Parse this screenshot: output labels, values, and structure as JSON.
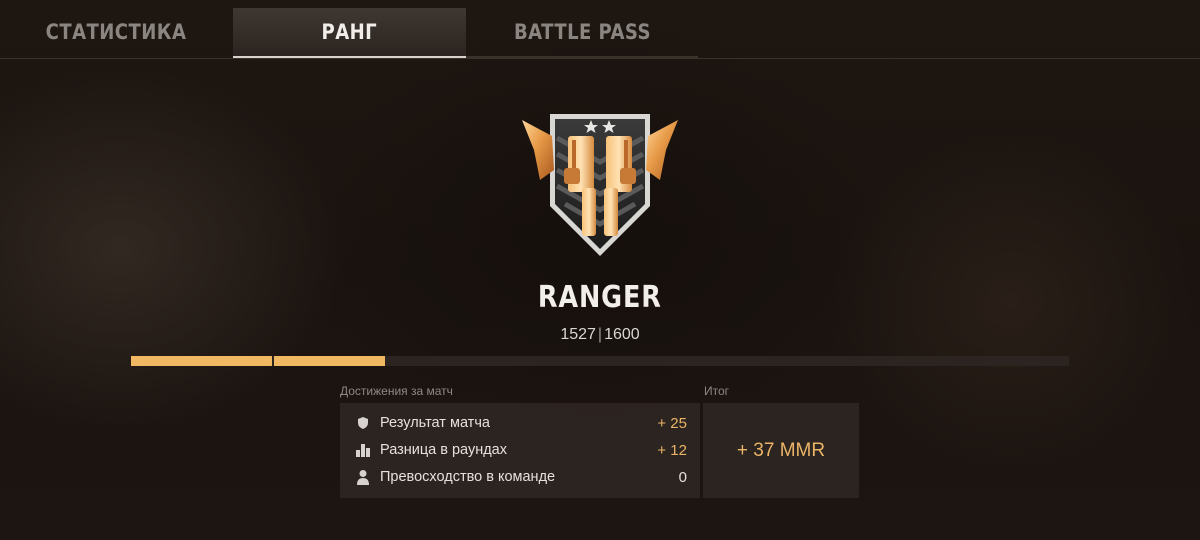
{
  "tabs": [
    {
      "label": "СТАТИСТИКА",
      "active": false
    },
    {
      "label": "РАНГ",
      "active": true
    },
    {
      "label": "BATTLE PASS",
      "active": false
    }
  ],
  "rank": {
    "name": "RANGER",
    "emblem_icon": "ranger-pistols-emblem-icon",
    "mmr_current": "1527",
    "mmr_separator": "|",
    "mmr_max": "1600",
    "progress_previous_fraction": 0.15,
    "progress_gain_fraction": 0.12
  },
  "achievements": {
    "title": "Достижения за матч",
    "rows": [
      {
        "icon": "shield-icon",
        "label": "Результат матча",
        "value": "+ 25"
      },
      {
        "icon": "bar-chart-icon",
        "label": "Разница в раундах",
        "value": "+ 12"
      },
      {
        "icon": "person-icon",
        "label": "Превосходство в команде",
        "value": "0"
      }
    ]
  },
  "total": {
    "title": "Итог",
    "value": "+ 37 MMR"
  },
  "colors": {
    "accent": "#f1b863",
    "background": "#1c1511",
    "text": "#e6e1dc"
  }
}
